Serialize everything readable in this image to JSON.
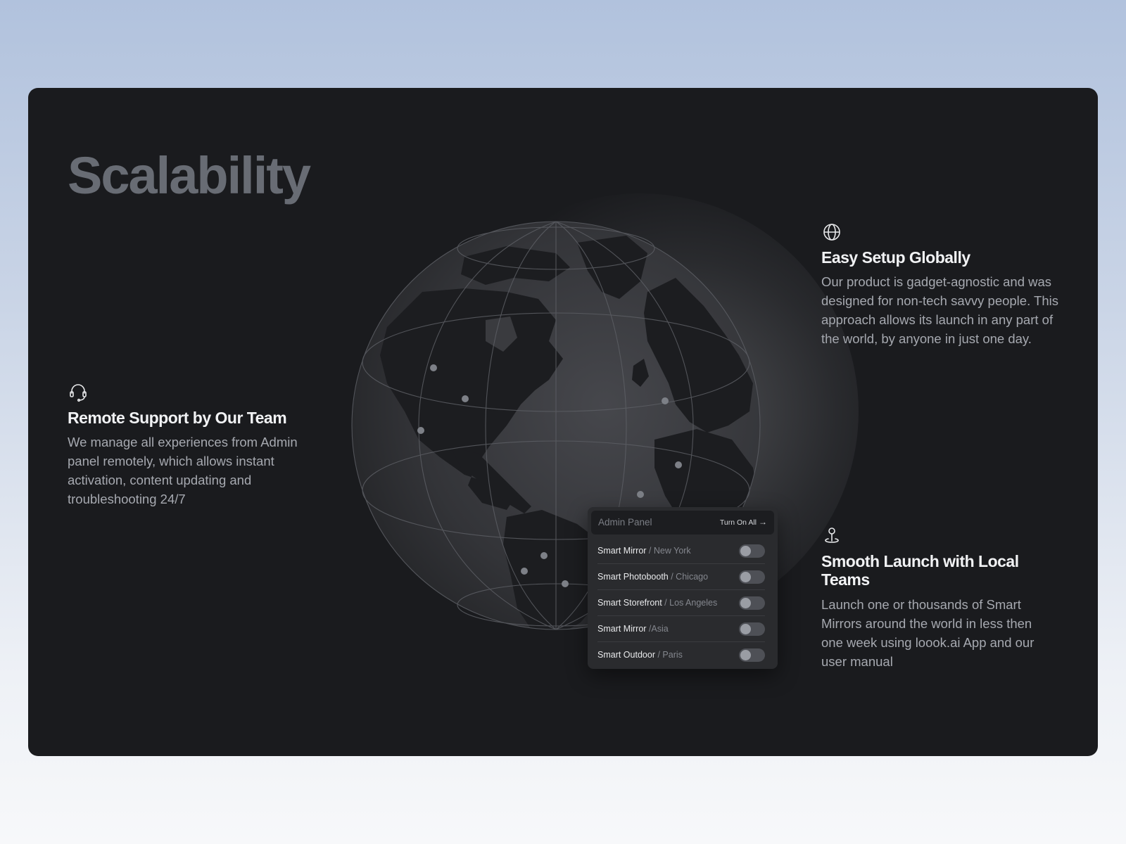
{
  "section": {
    "title": "Scalability"
  },
  "features": {
    "remote_support": {
      "icon": "headset-icon",
      "title": "Remote Support by Our Team",
      "description": "We manage all experiences from Admin panel remotely, which allows instant activation, content updating and troubleshooting 24/7"
    },
    "easy_setup": {
      "icon": "globe-icon",
      "title": "Easy Setup Globally",
      "description": "Our product is gadget-agnostic and was designed for non-tech savvy people. This approach allows its launch in any part of the world, by anyone in just one day."
    },
    "smooth_launch": {
      "icon": "map-pin-icon",
      "title": "Smooth Launch with Local Teams",
      "description": "Launch one or thousands of Smart Mirrors around the world in less then one week using loook.ai App and our user manual"
    }
  },
  "admin_panel": {
    "title": "Admin Panel",
    "turn_on_all_label": "Turn On All",
    "turn_on_all_icon": "arrow-right-icon",
    "devices": [
      {
        "name": "Smart Mirror",
        "location": " / New York",
        "enabled": false
      },
      {
        "name": "Smart Photobooth",
        "location": " / Chicago",
        "enabled": false
      },
      {
        "name": "Smart Storefront",
        "location": " / Los Angeles",
        "enabled": false
      },
      {
        "name": "Smart Mirror",
        "location": " /Asia",
        "enabled": false
      },
      {
        "name": "Smart Outdoor",
        "location": " / Paris",
        "enabled": false
      }
    ]
  },
  "colors": {
    "page_background_top": "#b1c2dd",
    "card_background": "#1a1b1e",
    "title_color": "#686c74",
    "heading_color": "#f1f2f4",
    "body_text_color": "#a6a9b0",
    "panel_background": "#2a2b2e",
    "toggle_off": "#4e5056"
  }
}
